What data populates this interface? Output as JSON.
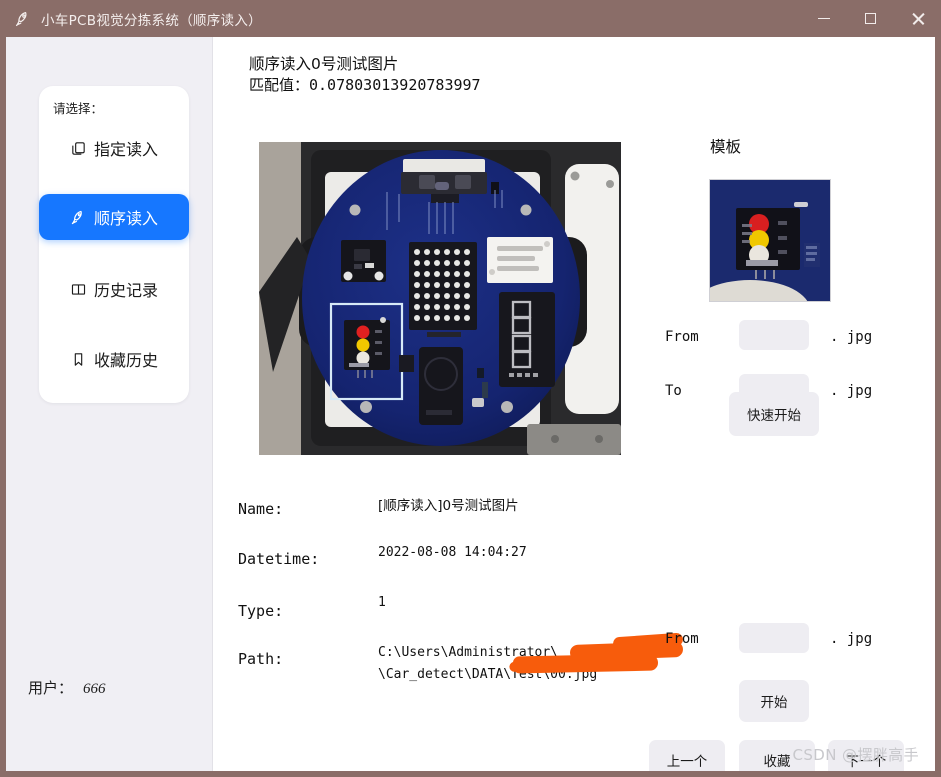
{
  "window": {
    "title": "小车PCB视觉分拣系统（顺序读入）",
    "icon": "rocket-icon",
    "titlebar_color": "#8a6d68",
    "controls": {
      "minimize": "—",
      "maximize": "□",
      "close": "✕"
    }
  },
  "sidebar": {
    "heading": "请选择：",
    "items": [
      {
        "label": "指定读入",
        "icon": "copy-icon",
        "active": false
      },
      {
        "label": "顺序读入",
        "icon": "rocket-icon",
        "active": true
      },
      {
        "label": "历史记录",
        "icon": "book-icon",
        "active": false
      },
      {
        "label": "收藏历史",
        "icon": "bookmark-icon",
        "active": false
      }
    ],
    "accent_color": "#1677ff",
    "panel_color": "#f0eff4",
    "user": {
      "label": "用户：",
      "value": "666"
    }
  },
  "main": {
    "header_title": "顺序读入0号测试图片",
    "header_score": "匹配值：0.07803013920783997",
    "photo": {
      "name": "pcb-car-photo",
      "description": "蓝色圆形PCB小车主板照片，含点阵屏、数码管与交通灯模块",
      "detection_box_label": ""
    },
    "template": {
      "label": "模板",
      "name": "template-photo",
      "description": "交通灯LED模块模板图"
    },
    "range_form": {
      "from_label": "From",
      "from_value": "",
      "from_placeholder": "",
      "to_label": "To",
      "to_value": "",
      "to_placeholder": "",
      "extension": ". jpg",
      "quick_start_label": "快速开始"
    },
    "details": [
      {
        "label": "Name:",
        "value": "[顺序读入]0号测试图片"
      },
      {
        "label": "Datetime:",
        "value": "2022-08-08 14:04:27"
      },
      {
        "label": "Type:",
        "value": "1"
      },
      {
        "label": "Path:",
        "value": "C:\\Users\\Administrator\\\n\\Car_detect\\DATA\\Test\\00.jpg"
      }
    ],
    "path_line1": "C:\\Users\\Administrator\\",
    "path_line2": "\\Car_detect\\DATA\\Test\\00.jpg",
    "redaction_color": "#f75c0c",
    "single_form": {
      "from_label": "From",
      "from_value": "",
      "extension": ". jpg",
      "start_label": "开始"
    },
    "nav_buttons": {
      "prev_label": "上一个",
      "favorite_label": "收藏",
      "next_label": "下一个"
    }
  },
  "watermark": "CSDN @摆胖高手"
}
